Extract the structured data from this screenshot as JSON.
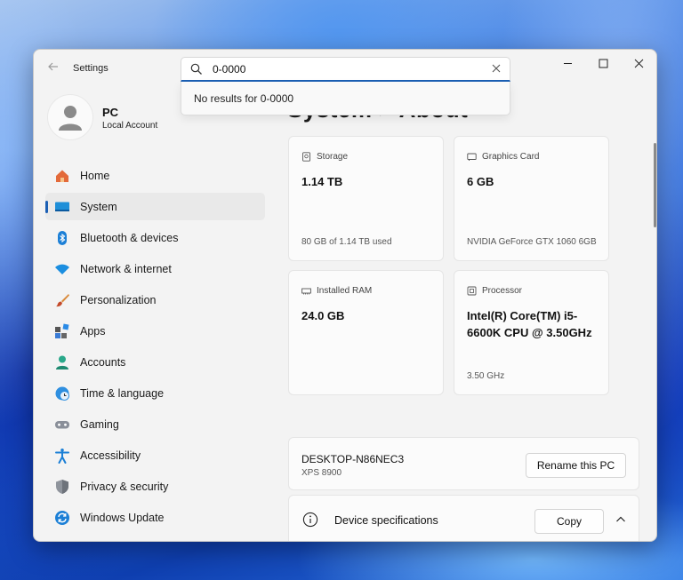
{
  "window": {
    "title": "Settings"
  },
  "search": {
    "value": "0-0000",
    "no_results": "No results for 0-0000"
  },
  "user": {
    "name": "PC",
    "account_type": "Local Account"
  },
  "nav": {
    "items": [
      {
        "label": "Home",
        "icon": "home-icon"
      },
      {
        "label": "System",
        "icon": "system-icon",
        "active": true
      },
      {
        "label": "Bluetooth & devices",
        "icon": "bluetooth-icon"
      },
      {
        "label": "Network & internet",
        "icon": "wifi-icon"
      },
      {
        "label": "Personalization",
        "icon": "brush-icon"
      },
      {
        "label": "Apps",
        "icon": "apps-icon"
      },
      {
        "label": "Accounts",
        "icon": "accounts-icon"
      },
      {
        "label": "Time & language",
        "icon": "globe-clock-icon"
      },
      {
        "label": "Gaming",
        "icon": "gamepad-icon"
      },
      {
        "label": "Accessibility",
        "icon": "accessibility-icon"
      },
      {
        "label": "Privacy & security",
        "icon": "shield-icon"
      },
      {
        "label": "Windows Update",
        "icon": "update-icon"
      }
    ]
  },
  "content": {
    "page_title": "System  >  About",
    "cards": {
      "storage": {
        "label": "Storage",
        "value": "1.14 TB",
        "foot": "80 GB of 1.14 TB used"
      },
      "graphics": {
        "label": "Graphics Card",
        "value": "6 GB",
        "foot": "NVIDIA GeForce GTX 1060 6GB"
      },
      "ram": {
        "label": "Installed RAM",
        "value": "24.0 GB",
        "foot": ""
      },
      "processor": {
        "label": "Processor",
        "value": "Intel(R) Core(TM) i5-6600K CPU @ 3.50GHz",
        "foot": "3.50 GHz"
      }
    },
    "device": {
      "name": "DESKTOP-N86NEC3",
      "model": "XPS 8900",
      "rename_label": "Rename this PC"
    },
    "specs": {
      "label": "Device specifications",
      "copy_label": "Copy"
    }
  },
  "colors": {
    "accent": "#1b5fb4"
  }
}
